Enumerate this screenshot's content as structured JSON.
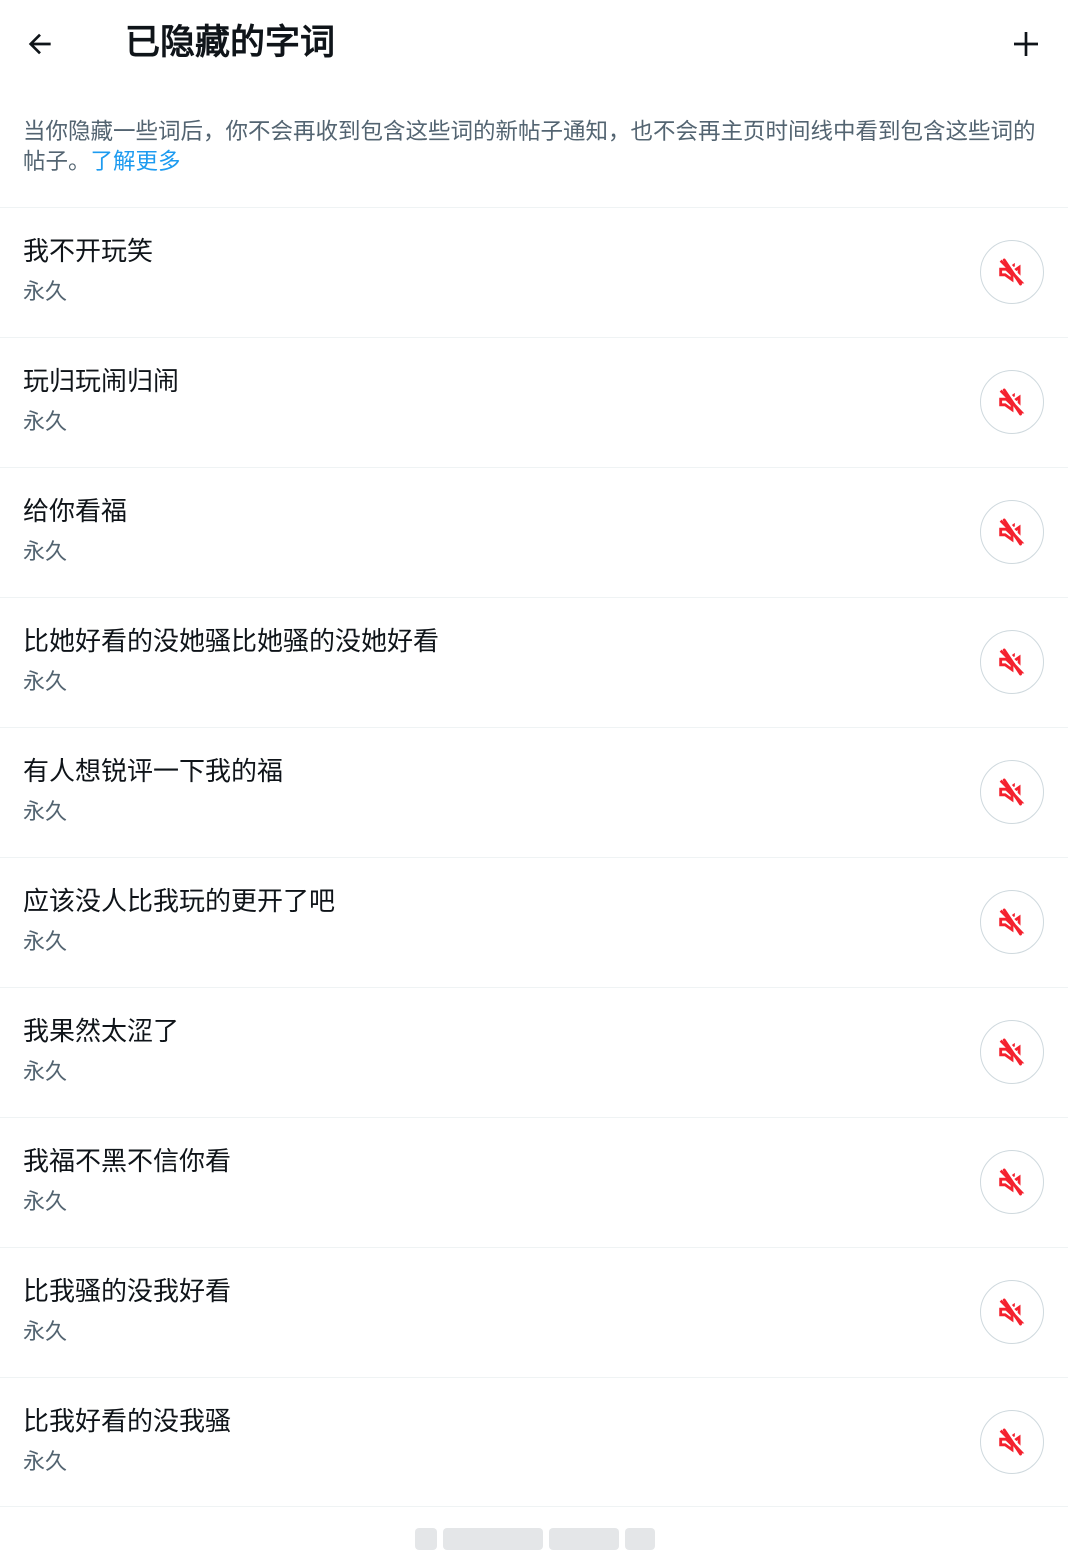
{
  "header": {
    "title": "已隐藏的字词",
    "back_icon": "arrow-left-icon",
    "add_icon": "plus-icon"
  },
  "description": {
    "text": "当你隐藏一些词后，你不会再收到包含这些词的新帖子通知，也不会再主页时间线中看到包含这些词的帖子。",
    "link_label": "了解更多"
  },
  "muted_words": [
    {
      "word": "我不开玩笑",
      "duration": "永久"
    },
    {
      "word": "玩归玩闹归闹",
      "duration": "永久"
    },
    {
      "word": "给你看福",
      "duration": "永久"
    },
    {
      "word": "比她好看的没她骚比她骚的没她好看",
      "duration": "永久"
    },
    {
      "word": "有人想锐评一下我的福",
      "duration": "永久"
    },
    {
      "word": "应该没人比我玩的更开了吧",
      "duration": "永久"
    },
    {
      "word": "我果然太涩了",
      "duration": "永久"
    },
    {
      "word": "我福不黑不信你看",
      "duration": "永久"
    },
    {
      "word": "比我骚的没我好看",
      "duration": "永久"
    },
    {
      "word": "比我好看的没我骚",
      "duration": "永久"
    }
  ],
  "colors": {
    "text_primary": "#0f1419",
    "text_secondary": "#536471",
    "link": "#1d9bf0",
    "mute_icon": "#f4212e",
    "divider": "#eff3f4"
  },
  "row_icon": "speaker-muted-icon"
}
